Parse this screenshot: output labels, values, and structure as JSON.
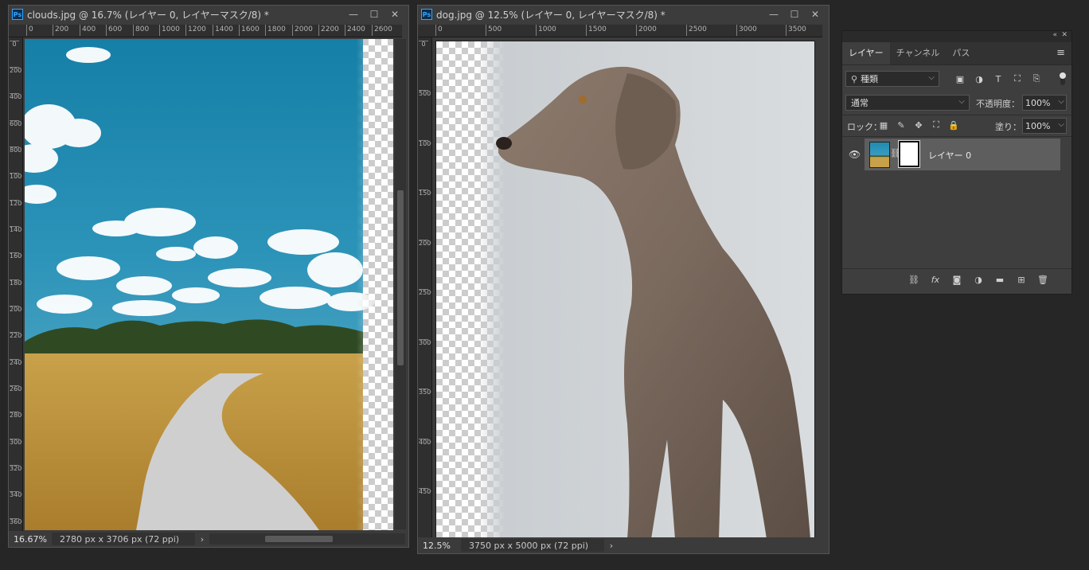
{
  "windows": {
    "clouds": {
      "title": "clouds.jpg @ 16.7% (レイヤー 0, レイヤーマスク/8) *",
      "zoom": "16.67%",
      "doc_info": "2780 px x 3706 px (72 ppi)",
      "ruler_h": [
        "0",
        "200",
        "400",
        "600",
        "800",
        "1000",
        "1200",
        "1400",
        "1600",
        "1800",
        "2000",
        "2200",
        "2400",
        "2600"
      ],
      "ruler_v": [
        "0",
        "200",
        "400",
        "600",
        "800",
        "1000",
        "1200",
        "1400",
        "1600",
        "1800",
        "2000",
        "2200",
        "2400",
        "2600",
        "2800",
        "3000",
        "3200",
        "3400",
        "3600"
      ]
    },
    "dog": {
      "title": "dog.jpg @ 12.5% (レイヤー 0, レイヤーマスク/8) *",
      "zoom": "12.5%",
      "doc_info": "3750 px x 5000 px (72 ppi)",
      "ruler_h": [
        "0",
        "500",
        "1000",
        "1500",
        "2000",
        "2500",
        "3000",
        "3500"
      ],
      "ruler_v": [
        "0",
        "500",
        "1000",
        "1500",
        "2000",
        "2500",
        "3000",
        "3500",
        "4000",
        "4500"
      ]
    }
  },
  "window_controls": {
    "minimize": "—",
    "maximize": "☐",
    "close": "✕"
  },
  "layers_panel": {
    "tabs": [
      "レイヤー",
      "チャンネル",
      "パス"
    ],
    "filter_kind": "種類",
    "blend_mode": "通常",
    "opacity_label": "不透明度：",
    "opacity_value": "100%",
    "lock_label": "ロック：",
    "fill_label": "塗り：",
    "fill_value": "100%",
    "layers": [
      {
        "name": "レイヤー 0"
      }
    ]
  },
  "colors": {
    "accent": "#31a8ff",
    "bg": "#262626",
    "panel": "#3e3e3e"
  }
}
